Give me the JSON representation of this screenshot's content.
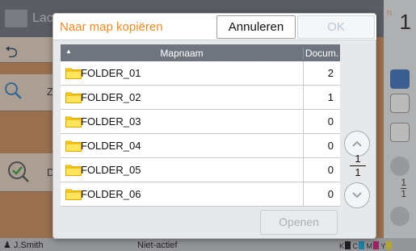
{
  "background": {
    "header_title": "Lac",
    "header_n": "n",
    "count_display": "1",
    "row_label_z": "Z",
    "row_label_d": "D",
    "right_fraction": {
      "top": "1",
      "bottom": "1"
    },
    "status": {
      "user": "J.Smith",
      "state": "Niet-actief",
      "ink_k": "K",
      "ink_c": "C",
      "ink_m": "M",
      "ink_y": "Y"
    }
  },
  "dialog": {
    "title": "Naar map kopiëren",
    "cancel_label": "Annuleren",
    "ok_label": "OK",
    "open_label": "Openen",
    "table": {
      "col_name": "Mapnaam",
      "col_count": "Docum.",
      "rows": [
        {
          "name": "FOLDER_01",
          "count": "2"
        },
        {
          "name": "FOLDER_02",
          "count": "1"
        },
        {
          "name": "FOLDER_03",
          "count": "0"
        },
        {
          "name": "FOLDER_04",
          "count": "0"
        },
        {
          "name": "FOLDER_05",
          "count": "0"
        },
        {
          "name": "FOLDER_06",
          "count": "0"
        }
      ]
    },
    "page": {
      "current": "1",
      "total": "1"
    }
  },
  "colors": {
    "accent_orange": "#f08a24",
    "header_gray": "#6f757e",
    "folder_yellow": "#ffd21a"
  }
}
